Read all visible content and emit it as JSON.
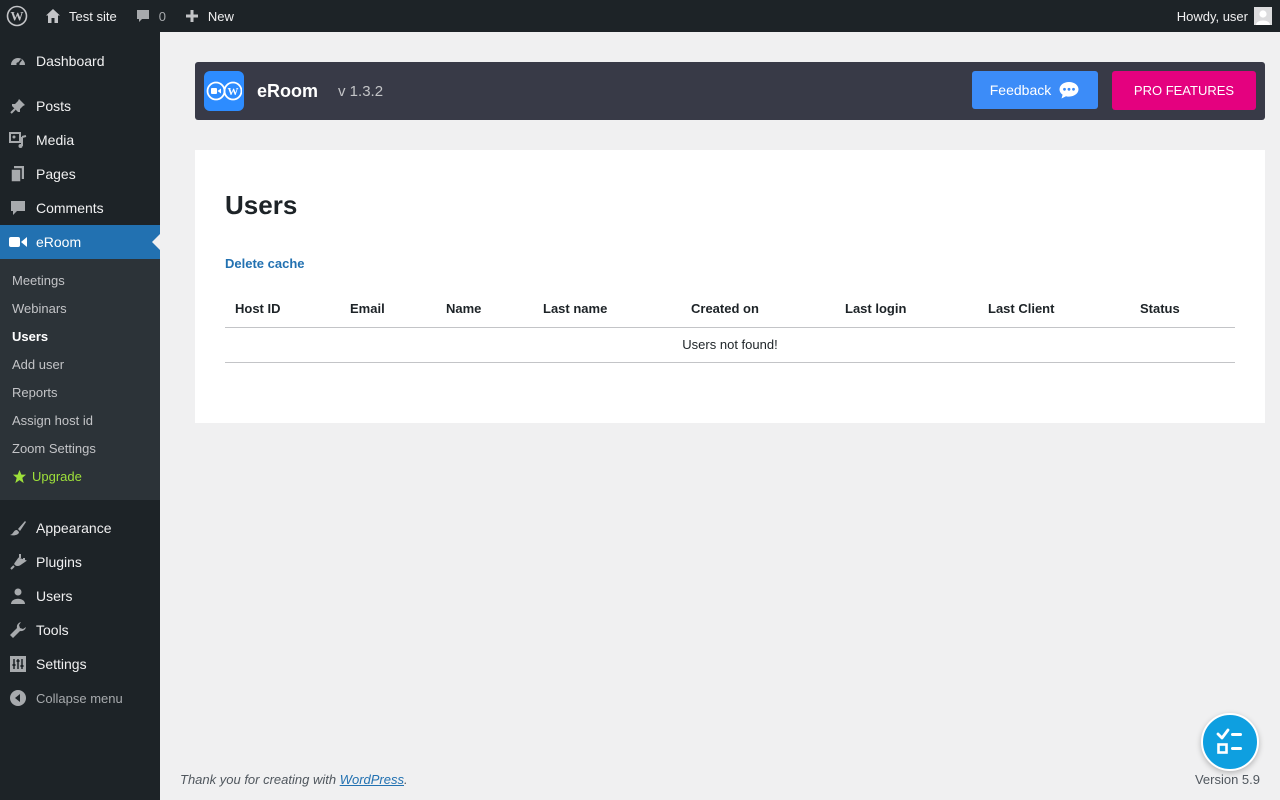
{
  "adminbar": {
    "site_name": "Test site",
    "comments_count": "0",
    "new_label": "New",
    "howdy": "Howdy, user"
  },
  "sidebar": {
    "items_top": [
      {
        "label": "Dashboard",
        "icon": "dashboard-icon"
      },
      {
        "label": "Posts",
        "icon": "pin-icon"
      },
      {
        "label": "Media",
        "icon": "media-icon"
      },
      {
        "label": "Pages",
        "icon": "pages-icon"
      },
      {
        "label": "Comments",
        "icon": "comment-icon"
      },
      {
        "label": "eRoom",
        "icon": "video-camera-icon"
      }
    ],
    "submenu": [
      {
        "label": "Meetings"
      },
      {
        "label": "Webinars"
      },
      {
        "label": "Users"
      },
      {
        "label": "Add user"
      },
      {
        "label": "Reports"
      },
      {
        "label": "Assign host id"
      },
      {
        "label": "Zoom Settings"
      },
      {
        "label": "Upgrade"
      }
    ],
    "items_bottom": [
      {
        "label": "Appearance",
        "icon": "paintbrush-icon"
      },
      {
        "label": "Plugins",
        "icon": "plugin-icon"
      },
      {
        "label": "Users",
        "icon": "user-icon"
      },
      {
        "label": "Tools",
        "icon": "wrench-icon"
      },
      {
        "label": "Settings",
        "icon": "settings-icon"
      }
    ],
    "collapse_label": "Collapse menu"
  },
  "plugin_header": {
    "name": "eRoom",
    "version": "v 1.3.2",
    "feedback_label": "Feedback",
    "pro_label": "PRO FEATURES"
  },
  "main": {
    "title": "Users",
    "delete_cache": "Delete cache",
    "columns": [
      "Host ID",
      "Email",
      "Name",
      "Last name",
      "Created on",
      "Last login",
      "Last Client",
      "Status"
    ],
    "empty_message": "Users not found!"
  },
  "footer": {
    "thanks_prefix": "Thank you for creating with ",
    "wordpress_link": "WordPress",
    "thanks_suffix": ".",
    "version": "Version 5.9"
  },
  "colors": {
    "accent": "#2271b1",
    "pro": "#e4017f",
    "feedback": "#3c8cf8",
    "upgrade": "#9ee03a"
  }
}
